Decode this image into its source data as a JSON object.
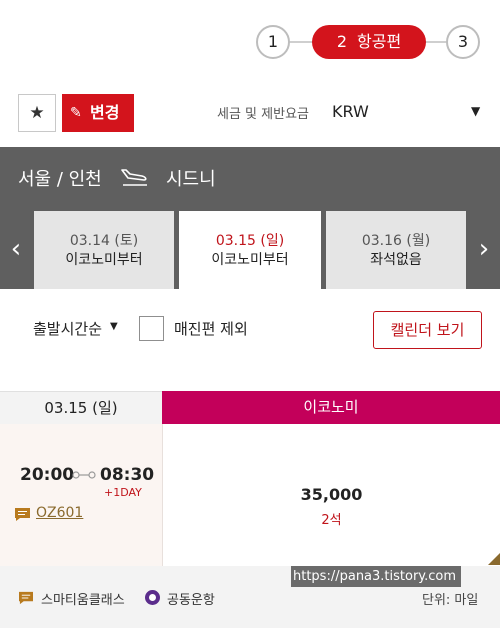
{
  "steps": {
    "step1": "1",
    "step2_number": "2",
    "step2_label": "항공편",
    "step3": "3"
  },
  "toolbar": {
    "favorite_icon": "star-icon",
    "change_label": "변경",
    "tax_label": "세금 및 제반요금",
    "currency": "KRW"
  },
  "route": {
    "origin": "서울 / 인천",
    "destination": "시드니"
  },
  "date_tabs": [
    {
      "date": "03.14 (토)",
      "fare": "이코노미부터"
    },
    {
      "date": "03.15 (일)",
      "fare": "이코노미부터"
    },
    {
      "date": "03.16 (월)",
      "fare": "좌석없음"
    }
  ],
  "filters": {
    "sort_label": "출발시간순",
    "soldout_label": "매진편 제외",
    "calendar_label": "캘린더 보기"
  },
  "results": {
    "date_header": "03.15 (일)",
    "class_header": "이코노미",
    "flights": [
      {
        "depart": "20:00",
        "arrive": "08:30",
        "day_offset": "+1DAY",
        "flight_no": "OZ601",
        "price": "35,000",
        "seats": "2석"
      }
    ]
  },
  "footer": {
    "legend_smartium": "스마티움클래스",
    "legend_codeshare": "공동운항",
    "unit": "단위: 마일"
  },
  "watermark": "https://pana3.tistory.com",
  "colors": {
    "accent_red": "#d3141c",
    "economy_header": "#c3005a",
    "route_bar": "#5f5f5f",
    "codeshare": "#5b2d8c",
    "smartium": "#b87a1e"
  }
}
